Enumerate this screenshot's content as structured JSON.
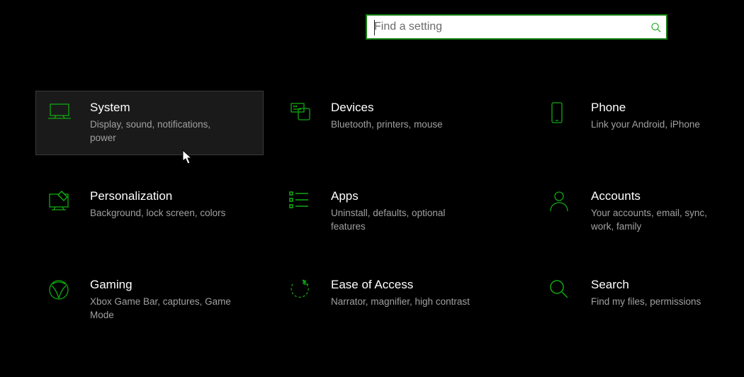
{
  "search": {
    "placeholder": "Find a setting"
  },
  "accent": "#10a810",
  "tiles": [
    {
      "id": "system",
      "title": "System",
      "desc": "Display, sound, notifications, power",
      "hovered": true
    },
    {
      "id": "devices",
      "title": "Devices",
      "desc": "Bluetooth, printers, mouse",
      "hovered": false
    },
    {
      "id": "phone",
      "title": "Phone",
      "desc": "Link your Android, iPhone",
      "hovered": false
    },
    {
      "id": "personalization",
      "title": "Personalization",
      "desc": "Background, lock screen, colors",
      "hovered": false
    },
    {
      "id": "apps",
      "title": "Apps",
      "desc": "Uninstall, defaults, optional features",
      "hovered": false
    },
    {
      "id": "accounts",
      "title": "Accounts",
      "desc": "Your accounts, email, sync, work, family",
      "hovered": false
    },
    {
      "id": "gaming",
      "title": "Gaming",
      "desc": "Xbox Game Bar, captures, Game Mode",
      "hovered": false
    },
    {
      "id": "ease-of-access",
      "title": "Ease of Access",
      "desc": "Narrator, magnifier, high contrast",
      "hovered": false
    },
    {
      "id": "search",
      "title": "Search",
      "desc": "Find my files, permissions",
      "hovered": false
    }
  ]
}
